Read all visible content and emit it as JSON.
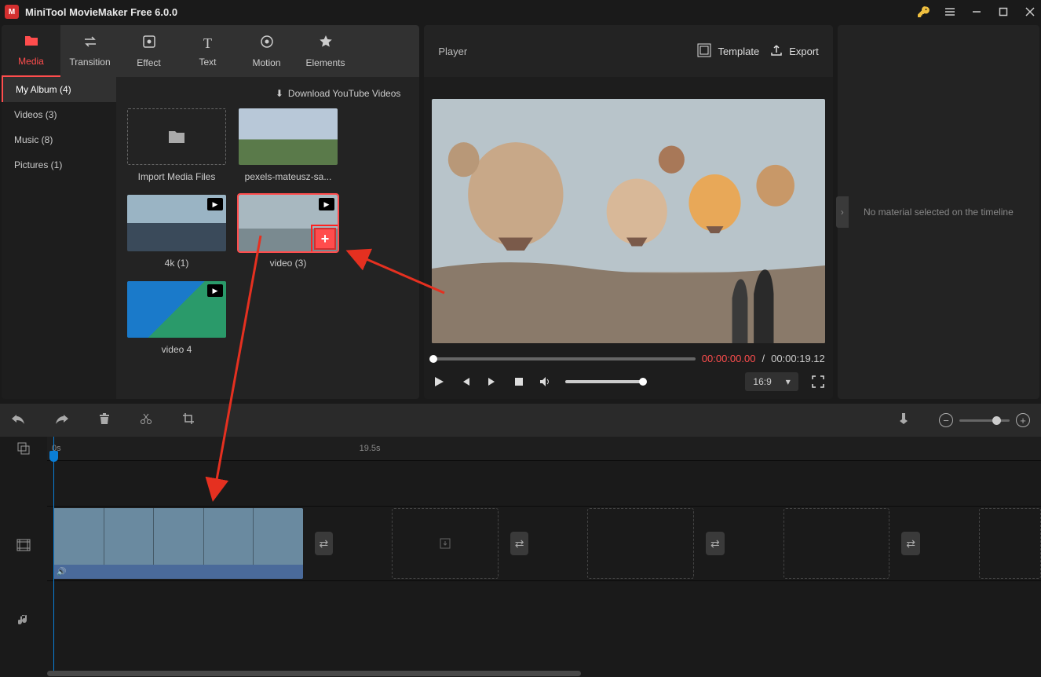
{
  "app": {
    "title": "MiniTool MovieMaker Free 6.0.0"
  },
  "toolbar": {
    "tabs": [
      {
        "label": "Media",
        "icon": "folder"
      },
      {
        "label": "Transition",
        "icon": "swap"
      },
      {
        "label": "Effect",
        "icon": "sparkle"
      },
      {
        "label": "Text",
        "icon": "text"
      },
      {
        "label": "Motion",
        "icon": "motion"
      },
      {
        "label": "Elements",
        "icon": "star"
      }
    ]
  },
  "sidebar": {
    "items": [
      {
        "label": "My Album (4)",
        "active": true
      },
      {
        "label": "Videos (3)"
      },
      {
        "label": "Music (8)"
      },
      {
        "label": "Pictures (1)"
      }
    ]
  },
  "media": {
    "download_link": "Download YouTube Videos",
    "import_label": "Import Media Files",
    "items": [
      {
        "label": "pexels-mateusz-sa...",
        "type": "image"
      },
      {
        "label": "4k (1)",
        "type": "video"
      },
      {
        "label": "video (3)",
        "type": "video",
        "selected": true,
        "show_add": true
      },
      {
        "label": "video 4",
        "type": "video"
      }
    ]
  },
  "player": {
    "header_label": "Player",
    "template_label": "Template",
    "export_label": "Export",
    "current_time": "00:00:00.00",
    "duration": "00:00:19.12",
    "aspect": "16:9"
  },
  "right_panel": {
    "empty_text": "No material selected on the timeline"
  },
  "timeline": {
    "ruler": {
      "start": "0s",
      "mid": "19.5s"
    },
    "zoom_minus": "−",
    "zoom_plus": "+"
  }
}
